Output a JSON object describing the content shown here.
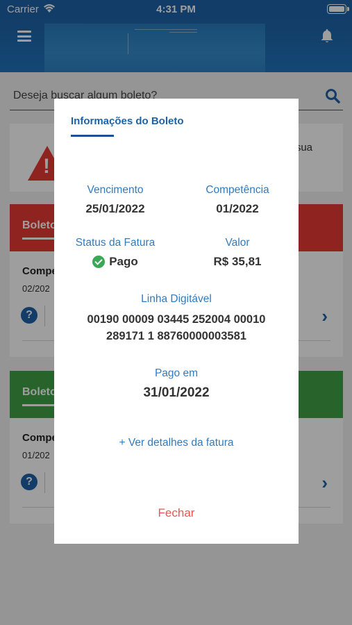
{
  "status_bar": {
    "carrier": "Carrier",
    "time": "4:31 PM"
  },
  "search": {
    "placeholder": "Deseja buscar algum boleto?"
  },
  "alert_card": {
    "partial_text": "sua"
  },
  "cards": [
    {
      "band_title": "Boleto",
      "band_color": "#e53935",
      "comp_label": "Compe",
      "comp_date": "02/202"
    },
    {
      "band_title": "Boleto",
      "band_color": "#43a047",
      "comp_label": "Compe",
      "comp_date": "01/202"
    }
  ],
  "modal": {
    "tab_title": "Informações do Boleto",
    "vencimento": {
      "label": "Vencimento",
      "value": "25/01/2022"
    },
    "competencia": {
      "label": "Competência",
      "value": "01/2022"
    },
    "status": {
      "label": "Status da Fatura",
      "value": "Pago",
      "color": "#3aa855"
    },
    "valor": {
      "label": "Valor",
      "value": "R$ 35,81"
    },
    "linha_digitavel": {
      "label": "Linha Digitável",
      "line1": "00190 00009 03445 252004 00010",
      "line2": "289171 1 88760000003581"
    },
    "pago_em": {
      "label": "Pago em",
      "value": "31/01/2022"
    },
    "details_link": "+ Ver detalhes da fatura",
    "close_label": "Fechar"
  },
  "colors": {
    "primary": "#1d63a8",
    "accent_blue": "#2f7bc0",
    "danger": "#ef5350",
    "success": "#3aa855"
  }
}
